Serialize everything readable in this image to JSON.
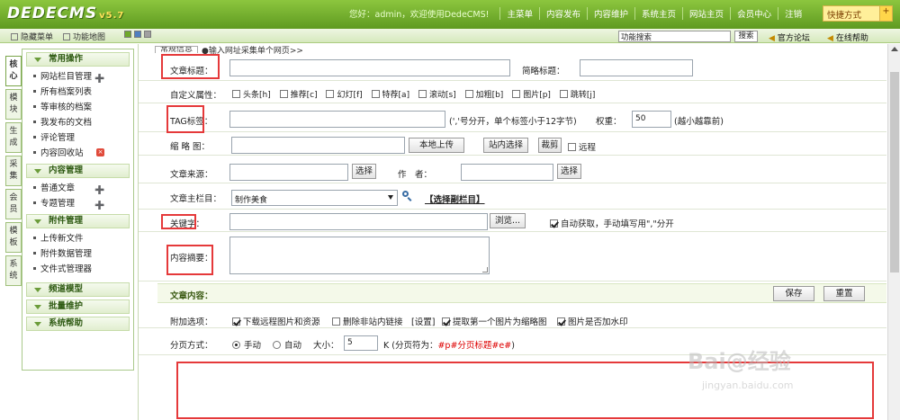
{
  "header": {
    "logo": "DEDECMS",
    "version": "v5.7",
    "welcome": "您好：admin，欢迎使用DedeCMS!",
    "nav": [
      "主菜单",
      "内容发布",
      "内容维护",
      "系统主页",
      "网站主页",
      "会员中心",
      "注销"
    ],
    "quick": "快捷方式",
    "plus": "+"
  },
  "subbar": {
    "hide_menu": "隐藏菜单",
    "func_map": "功能地图",
    "search_value": "功能搜索",
    "search_btn": "搜索",
    "forum": "官方论坛",
    "help": "在线帮助"
  },
  "vtabs": [
    "核心",
    "模块",
    "生成",
    "采集",
    "会员",
    "模板",
    "系统"
  ],
  "sidebar": {
    "g1": {
      "title": "常用操作",
      "items": [
        "网站栏目管理",
        "所有档案列表",
        "等审核的档案",
        "我发布的文档",
        "评论管理",
        "内容回收站"
      ]
    },
    "g2": {
      "title": "内容管理",
      "items": [
        "普通文章",
        "专题管理"
      ]
    },
    "g3": {
      "title": "附件管理",
      "items": [
        "上传新文件",
        "附件数据管理",
        "文件式管理器"
      ]
    },
    "g4": {
      "title": "频道模型"
    },
    "g5": {
      "title": "批量维护"
    },
    "g6": {
      "title": "系统帮助"
    }
  },
  "form": {
    "tab1": "常规信息",
    "tab2": "●输入网址采集单个网页>>",
    "title_lbl": "文章标题：",
    "short_lbl": "简略标题：",
    "flags_lbl": "自定义属性：",
    "flags": [
      {
        "label": "头条[h]",
        "on": false
      },
      {
        "label": "推荐[c]",
        "on": false
      },
      {
        "label": "幻灯[f]",
        "on": false
      },
      {
        "label": "特荐[a]",
        "on": false
      },
      {
        "label": "滚动[s]",
        "on": false
      },
      {
        "label": "加粗[b]",
        "on": false
      },
      {
        "label": "图片[p]",
        "on": false
      },
      {
        "label": "跳转[j]",
        "on": false
      }
    ],
    "tag_lbl": "TAG标签：",
    "tag_hint": "(','号分开，单个标签小于12字节)",
    "weight_lbl": "权重：",
    "weight": "50",
    "weight_hint": "(越小越靠前)",
    "thumb_lbl": "缩 略 图：",
    "upload": "本地上传",
    "site_select": "站内选择",
    "crop": "裁剪",
    "remote": "远程",
    "source_lbl": "文章来源：",
    "choose": "选择",
    "author_lbl": "作　者：",
    "column_lbl": "文章主栏目：",
    "column": "制作美食",
    "sub_column": "【选择副栏目】",
    "kw_lbl": "关键字：",
    "browse": "浏览...",
    "auto_kw": "自动获取，手动填写用\",\"分开",
    "summary_lbl": "内容摘要：",
    "content_title": "文章内容：",
    "save": "保存",
    "reset": "重置",
    "extra_lbl": "附加选项：",
    "extra": [
      "下载远程图片和资源",
      "删除非站内链接",
      "[设置]",
      "提取第一个图片为缩略图",
      "图片是否加水印"
    ],
    "paging_lbl": "分页方式：",
    "manual": "手动",
    "auto": "自动",
    "size_lbl": "大小：",
    "size": "5",
    "paging_hint": "K (分页符为：",
    "paging_tag": "#p#分页标题#e#",
    "paging_end": ")"
  },
  "watermark": {
    "brand": "Bai@经验",
    "url": "jingyan.baidu.com"
  },
  "colors": {
    "header_green": "#6fa82b",
    "highlight_red": "#e5393a",
    "section_bg": "#f4f9e9"
  }
}
